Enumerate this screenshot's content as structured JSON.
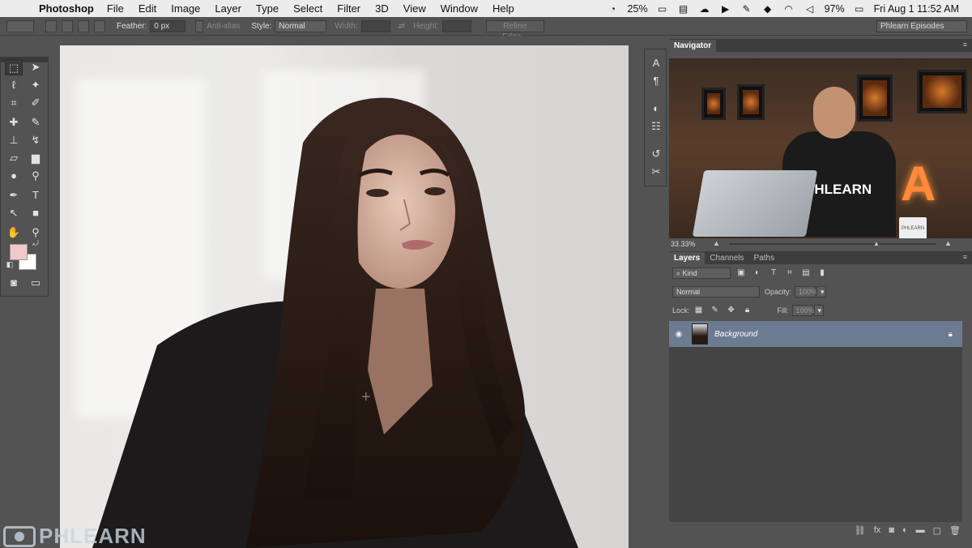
{
  "menubar": {
    "app_name": "Photoshop",
    "items": [
      "File",
      "Edit",
      "Image",
      "Layer",
      "Type",
      "Select",
      "Filter",
      "3D",
      "View",
      "Window",
      "Help"
    ],
    "status": {
      "cpu": "25%",
      "battery": "97%",
      "datetime": "Fri Aug 1  11:52 AM"
    }
  },
  "options_bar": {
    "feather_label": "Feather:",
    "feather_value": "0 px",
    "antialias_label": "Anti-alias",
    "style_label": "Style:",
    "style_value": "Normal",
    "width_label": "Width:",
    "height_label": "Height:",
    "refine_edge_label": "Refine Edge...",
    "workspace": "Phlearn Episodes"
  },
  "colors": {
    "foreground": "#f2c9c6",
    "background": "#ffffff"
  },
  "navigator": {
    "tab_label": "Navigator",
    "zoom": "33.33%",
    "preview_shirt_text": "PHLEARN",
    "preview_mug_text": "PHLEARN",
    "preview_sign": "A"
  },
  "layers_panel": {
    "tabs": [
      "Layers",
      "Channels",
      "Paths"
    ],
    "filter_kind": "Kind",
    "blend_mode": "Normal",
    "opacity_label": "Opacity:",
    "opacity_value": "100%",
    "lock_label": "Lock:",
    "fill_label": "Fill:",
    "fill_value": "100%",
    "layers": [
      {
        "name": "Background",
        "visible": true,
        "locked": true,
        "selected": true
      }
    ]
  },
  "watermark": {
    "text": "PHLEARN"
  }
}
